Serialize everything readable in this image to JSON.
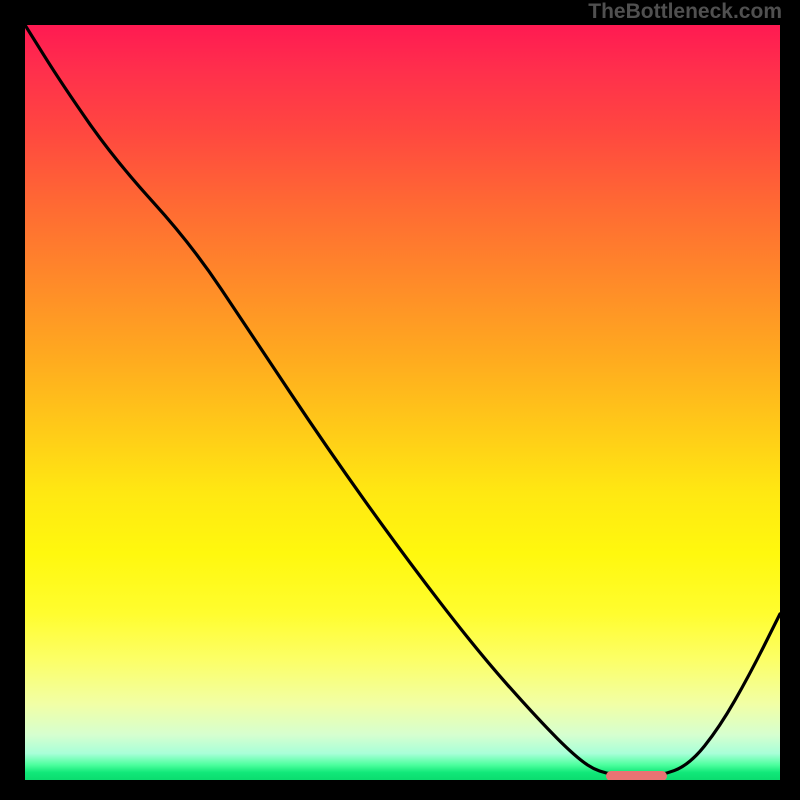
{
  "watermark": "TheBottleneck.com",
  "chart_data": {
    "type": "line",
    "title": "",
    "xlabel": "",
    "ylabel": "",
    "x_range": [
      0,
      100
    ],
    "y_range": [
      0,
      100
    ],
    "description": "Bottleneck percentage curve over a red-yellow-green gradient; minimum (optimal) region marked in salmon near x≈78-84.",
    "series": [
      {
        "name": "bottleneck-curve",
        "x": [
          0,
          5,
          12,
          22,
          30,
          40,
          50,
          60,
          68,
          73,
          76,
          80,
          84,
          88,
          92,
          96,
          100
        ],
        "y": [
          100,
          92,
          82,
          71,
          59,
          44,
          30,
          17,
          8,
          3,
          1,
          0.5,
          0.5,
          2,
          7,
          14,
          22
        ]
      }
    ],
    "optimum_band": {
      "x_start": 77,
      "x_end": 85,
      "y": 0.5
    },
    "gradient_stops": [
      {
        "pos": 0.0,
        "color": "#ff1a52"
      },
      {
        "pos": 0.5,
        "color": "#ffcc18"
      },
      {
        "pos": 0.8,
        "color": "#fffd2f"
      },
      {
        "pos": 0.97,
        "color": "#a8ffd8"
      },
      {
        "pos": 1.0,
        "color": "#0bdc6f"
      }
    ]
  }
}
